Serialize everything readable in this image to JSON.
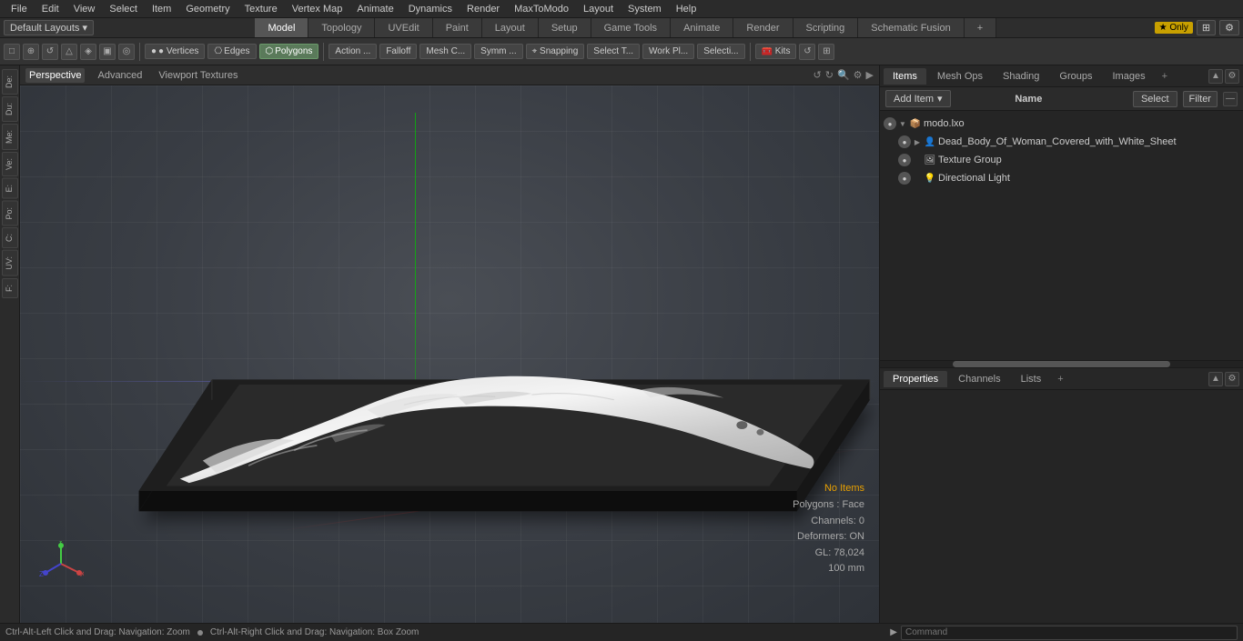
{
  "menubar": {
    "items": [
      {
        "label": "File"
      },
      {
        "label": "Edit"
      },
      {
        "label": "View"
      },
      {
        "label": "Select"
      },
      {
        "label": "Item"
      },
      {
        "label": "Geometry"
      },
      {
        "label": "Texture"
      },
      {
        "label": "Vertex Map"
      },
      {
        "label": "Animate"
      },
      {
        "label": "Dynamics"
      },
      {
        "label": "Render"
      },
      {
        "label": "MaxToModo"
      },
      {
        "label": "Layout"
      },
      {
        "label": "System"
      },
      {
        "label": "Help"
      }
    ]
  },
  "layout_bar": {
    "selector_label": "Default Layouts ▾",
    "tabs": [
      {
        "label": "Model",
        "active": true
      },
      {
        "label": "Topology"
      },
      {
        "label": "UVEdit"
      },
      {
        "label": "Paint"
      },
      {
        "label": "Layout"
      },
      {
        "label": "Setup"
      },
      {
        "label": "Game Tools"
      },
      {
        "label": "Animate"
      },
      {
        "label": "Render"
      },
      {
        "label": "Scripting"
      },
      {
        "label": "Schematic Fusion"
      },
      {
        "label": "+"
      }
    ],
    "star_label": "★ Only",
    "expand_btn": "⊞",
    "settings_btn": "⚙"
  },
  "toolbar": {
    "btns": [
      {
        "label": "⬜"
      },
      {
        "label": "⊕"
      },
      {
        "label": "⟳"
      },
      {
        "label": "△"
      },
      {
        "label": "✦"
      },
      {
        "label": "▣"
      },
      {
        "label": "◎"
      }
    ],
    "component_btns": [
      {
        "label": "● Vertices",
        "active": false
      },
      {
        "label": "⎔ Edges",
        "active": false
      },
      {
        "label": "⬡ Polygons",
        "active": true
      }
    ],
    "action_btn": "Action ...",
    "falloff_btn": "Falloff",
    "mesh_btn": "Mesh C...",
    "symm_btn": "Symm ...",
    "snap_btn": "⌖ Snapping",
    "select_btn": "Select T...",
    "work_btn": "Work Pl...",
    "selecti_btn": "Selecti...",
    "kits_btn": "🧰 Kits",
    "nav_btn1": "⟲",
    "nav_btn2": "⊞"
  },
  "viewport": {
    "tabs": [
      {
        "label": "Perspective",
        "active": true
      },
      {
        "label": "Advanced"
      },
      {
        "label": "Viewport Textures"
      }
    ],
    "controls": [
      "↺",
      "↻",
      "🔍",
      "⚙",
      "▶"
    ],
    "status": {
      "no_items": "No Items",
      "polygons": "Polygons : Face",
      "channels": "Channels: 0",
      "deformers": "Deformers: ON",
      "gl": "GL: 78,024",
      "unit": "100 mm"
    }
  },
  "left_sidebar": {
    "tabs": [
      "De:",
      "Du:",
      "Me:",
      "Ve:",
      "E:",
      "Po:",
      "C:",
      "UV:",
      "F:"
    ]
  },
  "right_panel": {
    "items_tabs": [
      {
        "label": "Items",
        "active": true
      },
      {
        "label": "Mesh Ops"
      },
      {
        "label": "Shading"
      },
      {
        "label": "Groups"
      },
      {
        "label": "Images"
      },
      {
        "label": "+"
      }
    ],
    "add_item_label": "Add Item",
    "name_col": "Name",
    "select_btn": "Select",
    "filter_btn": "Filter",
    "items": [
      {
        "id": 1,
        "indent": 0,
        "expand": "▼",
        "icon": "📦",
        "label": "modo.lxo",
        "has_vis": true
      },
      {
        "id": 2,
        "indent": 1,
        "expand": "▶",
        "icon": "👤",
        "label": "Dead_Body_Of_Woman_Covered_with_White_Sheet",
        "has_vis": true
      },
      {
        "id": 3,
        "indent": 1,
        "expand": "",
        "icon": "🖼",
        "label": "Texture Group",
        "has_vis": true
      },
      {
        "id": 4,
        "indent": 1,
        "expand": "",
        "icon": "💡",
        "label": "Directional Light",
        "has_vis": true
      }
    ],
    "properties_tabs": [
      {
        "label": "Properties",
        "active": true
      },
      {
        "label": "Channels"
      },
      {
        "label": "Lists"
      },
      {
        "label": "+"
      }
    ]
  },
  "status_bar": {
    "hint": "Ctrl-Alt-Left Click and Drag: Navigation: Zoom",
    "dot_label": "●",
    "hint2": "Ctrl-Alt-Right Click and Drag: Navigation: Box Zoom",
    "command_prompt": "Command",
    "command_placeholder": "Command"
  }
}
